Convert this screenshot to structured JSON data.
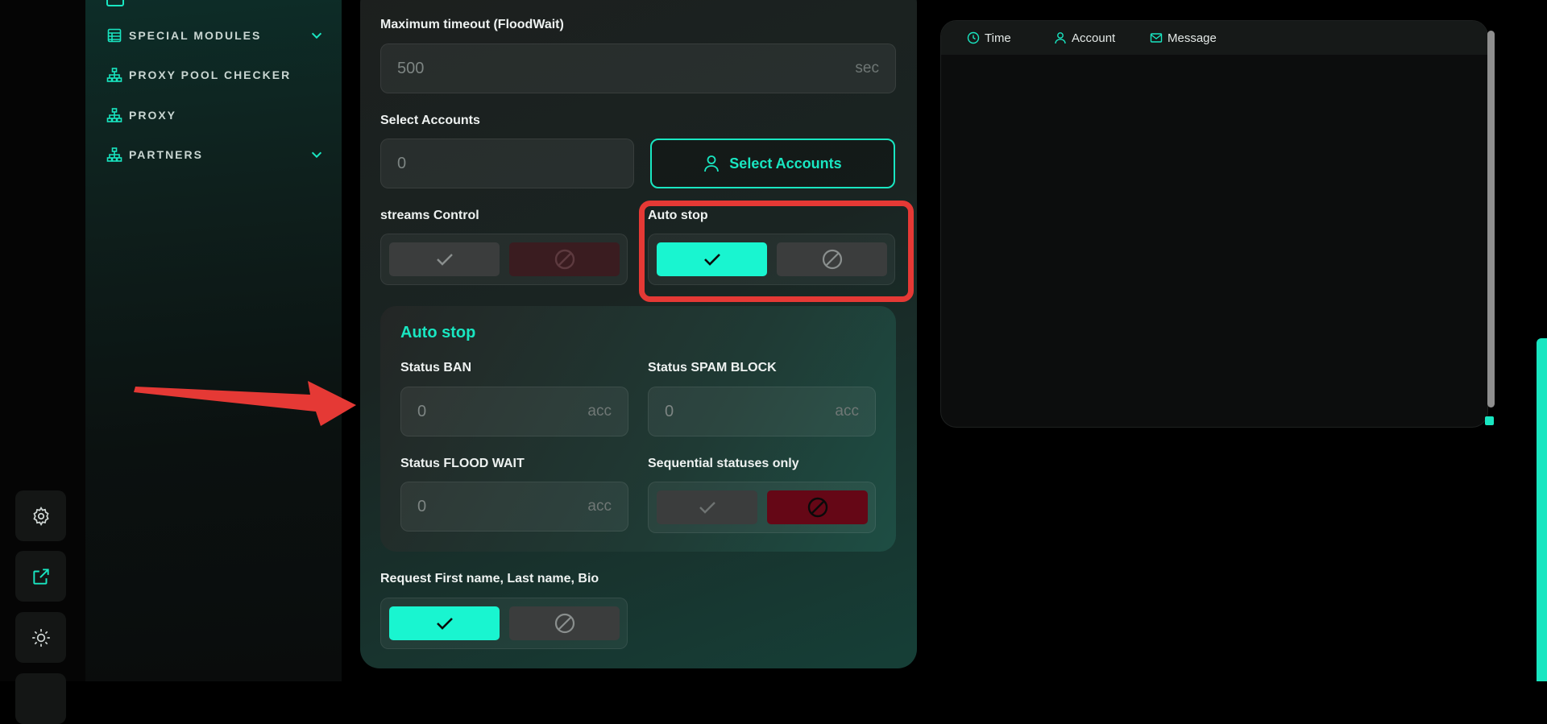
{
  "sidebar": {
    "items": [
      {
        "label": "SPECIAL MODULES",
        "icon": "table-icon",
        "expandable": true
      },
      {
        "label": "PROXY POOL CHECKER",
        "icon": "network-icon",
        "expandable": false
      },
      {
        "label": "PROXY",
        "icon": "network-icon",
        "expandable": false
      },
      {
        "label": "PARTNERS",
        "icon": "network-icon",
        "expandable": true
      }
    ]
  },
  "rail": {
    "icons": [
      "gear-icon",
      "external-link-icon",
      "theme-toggle-icon"
    ]
  },
  "form": {
    "max_timeout": {
      "label": "Maximum timeout (FloodWait)",
      "value": "500",
      "unit": "sec"
    },
    "select_accounts": {
      "label": "Select Accounts",
      "value": "0",
      "button_label": "Select Accounts"
    },
    "streams_control": {
      "label": "streams Control",
      "state": "off"
    },
    "auto_stop": {
      "label": "Auto stop",
      "state": "on"
    },
    "auto_stop_panel": {
      "title": "Auto stop",
      "status_ban": {
        "label": "Status BAN",
        "value": "0",
        "unit": "acc"
      },
      "status_spam_block": {
        "label": "Status SPAM BLOCK",
        "value": "0",
        "unit": "acc"
      },
      "status_flood_wait": {
        "label": "Status FLOOD WAIT",
        "value": "0",
        "unit": "acc"
      },
      "sequential_only": {
        "label": "Sequential statuses only",
        "state": "off"
      }
    },
    "request_profile": {
      "label": "Request First name, Last name, Bio",
      "state": "on"
    }
  },
  "log": {
    "columns": [
      {
        "label": "Time",
        "icon": "clock-icon"
      },
      {
        "label": "Account",
        "icon": "user-icon"
      },
      {
        "label": "Message",
        "icon": "mail-icon"
      }
    ]
  },
  "colors": {
    "accent": "#19e6c1",
    "accent_bright": "#19f5d0",
    "danger": "#650716",
    "annotation": "#e53935"
  }
}
